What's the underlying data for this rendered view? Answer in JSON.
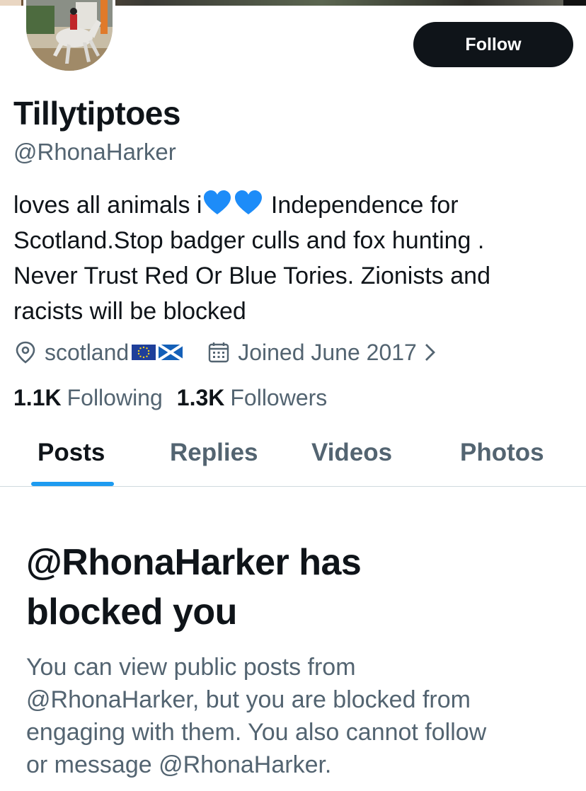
{
  "profile": {
    "follow_label": "Follow",
    "display_name": "Tillytiptoes",
    "handle": "@RhonaHarker",
    "bio_lines": [
      "loves all animals i",
      " Independence for",
      "Scotland.Stop badger culls and fox hunting .",
      "Never Trust Red Or Blue Tories. Zionists and",
      "racists will be blocked"
    ],
    "location": "scotland",
    "joined": "Joined June 2017",
    "following_count": "1.1K",
    "following_label": "Following",
    "followers_count": "1.3K",
    "followers_label": "Followers"
  },
  "tabs": {
    "posts": "Posts",
    "replies": "Replies",
    "videos": "Videos",
    "photos": "Photos"
  },
  "blocked": {
    "title_lines": [
      "@RhonaHarker has",
      "blocked you"
    ],
    "body_lines": [
      "You can view public posts from",
      "@RhonaHarker, but you are blocked from",
      "engaging with them. You also cannot follow",
      "or message @RhonaHarker."
    ]
  },
  "colors": {
    "accent": "#1d9bf0",
    "text_primary": "#0f1419",
    "text_secondary": "#536471",
    "button_bg": "#0f1419",
    "heart": "#1d8cf8"
  }
}
